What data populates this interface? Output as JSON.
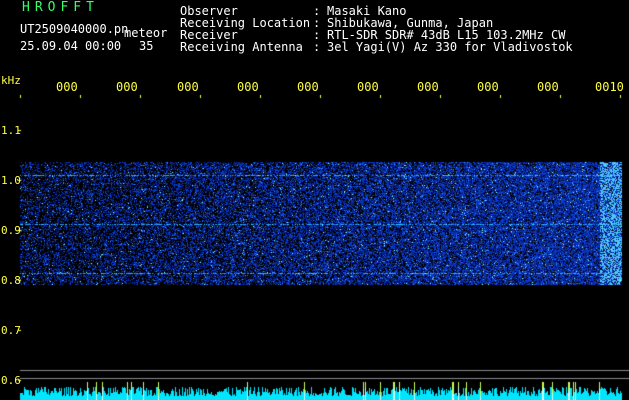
{
  "header": {
    "app_name": "HROFFT",
    "filename": "UT2509040000.pn",
    "mode": "meteor",
    "timestamp": "25.09.04 00:00",
    "count": "35",
    "fields": [
      {
        "label": "Observer",
        "value": "Masaki Kano"
      },
      {
        "label": "Receiving Location",
        "value": "Shibukawa, Gunma, Japan"
      },
      {
        "label": "Receiver",
        "value": "RTL-SDR SDR# 43dB L15 103.2MHz CW"
      },
      {
        "label": "Receiving Antenna",
        "value": "3el Yagi(V) Az 330 for Vladivostok"
      }
    ],
    "separator": ":"
  },
  "axis": {
    "unit": "kHz",
    "y_ticks": [
      "1.1",
      "1.0",
      "0.9",
      "0.8",
      "0.7",
      "0.6"
    ],
    "x_ticks": [
      "000",
      "000",
      "000",
      "000",
      "000",
      "000",
      "000",
      "000",
      "000",
      "0010"
    ]
  },
  "colors": {
    "text_white": "#ffffff",
    "text_green": "#33ff66",
    "text_yellow": "#ffff44",
    "signal_low": "#0a1a9a",
    "signal_mid": "#3a6cff",
    "signal_high": "#a0ffff"
  }
}
